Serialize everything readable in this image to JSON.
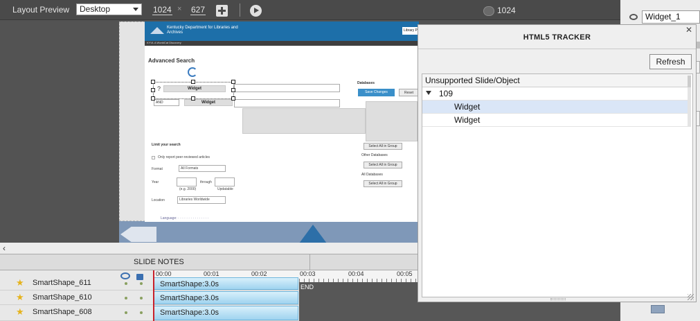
{
  "toolbar": {
    "layout_preview_label": "Layout Preview",
    "device_value": "Desktop",
    "width_value": "1024",
    "times_sign": "×",
    "height_value": "627",
    "slider_value": "1024"
  },
  "properties_panel": {
    "widget_name": "Widget_1"
  },
  "slide": {
    "org_name": "Kentucky Department for Libraries and Archives",
    "header_sub": "KYVL A WorldCat Discovery",
    "search_title": "Advanced Search",
    "widget_label_1": "Widget",
    "widget_label_2": "Widget",
    "and_value": "AND",
    "question_mark": "?",
    "databases_label": "Databases",
    "save_changes": "Save Changes",
    "reset": "Reset",
    "library_btn": "Library P",
    "limit_search": "Limit your search",
    "peer_reviewed": "Only report peer-reviewed articles",
    "format_label": "Format",
    "format_value": "All Formats",
    "year_label": "Year",
    "through_label": "through",
    "year_hint_1": "(e.g. 2000)",
    "year_hint_2": "Updatable",
    "location_label": "Location",
    "location_value": "Libraries Worldwide",
    "select_all_1": "Select All in Group",
    "other_databases": "Other Databases",
    "select_all_2": "Select All in Group",
    "all_databases": "All Databases",
    "select_all_3": "Select All in Group",
    "languages_line": "Language: · · · · · · · · · · · · · · ·"
  },
  "slide_notes": {
    "label": "SLIDE NOTES"
  },
  "timeline": {
    "ruler_ticks": [
      "00:00",
      "00:01",
      "00:02",
      "00:03",
      "00:04",
      "00:05"
    ],
    "end_label": "END",
    "rows": [
      {
        "name": "SmartShape_611",
        "clip": "SmartShape:3.0s"
      },
      {
        "name": "SmartShape_610",
        "clip": "SmartShape:3.0s"
      },
      {
        "name": "SmartShape_608",
        "clip": "SmartShape:3.0s"
      }
    ]
  },
  "tracker": {
    "title": "HTML5 TRACKER",
    "refresh_label": "Refresh",
    "column_header": "Unsupported Slide/Object",
    "group_label": "109",
    "items": [
      "Widget",
      "Widget"
    ]
  }
}
